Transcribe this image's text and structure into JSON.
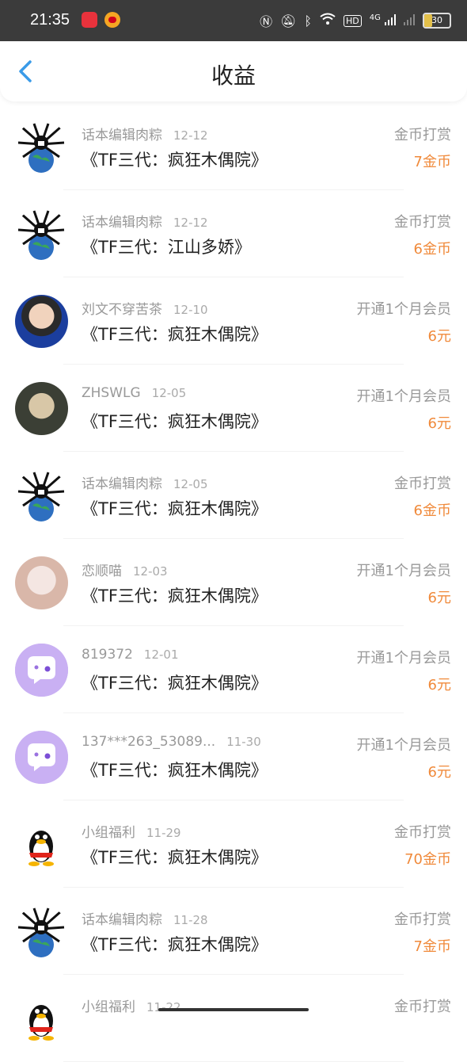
{
  "status_bar": {
    "time": "21:35",
    "network_label": "4G",
    "battery": "30",
    "hd_label": "HD"
  },
  "header": {
    "title": "收益",
    "back_icon": "chevron-left-icon"
  },
  "colors": {
    "accent_blue": "#3a9be8",
    "amount_orange": "#f08a3b",
    "avatar_default": "#c9b0f3"
  },
  "rows": [
    {
      "avatar": "spider-avatar",
      "user": "话本编辑肉粽",
      "date": "12-12",
      "title": "《TF三代：疯狂木偶院》",
      "type": "金币打赏",
      "amount": "7金币"
    },
    {
      "avatar": "spider-avatar",
      "user": "话本编辑肉粽",
      "date": "12-12",
      "title": "《TF三代：江山多娇》",
      "type": "金币打赏",
      "amount": "6金币"
    },
    {
      "avatar": "person-avatar",
      "user": "刘文不穿苦茶",
      "date": "12-10",
      "title": "《TF三代：疯狂木偶院》",
      "type": "开通1个月会员",
      "amount": "6元"
    },
    {
      "avatar": "person-avatar",
      "user": "ZHSWLG",
      "date": "12-05",
      "title": "《TF三代：疯狂木偶院》",
      "type": "开通1个月会员",
      "amount": "6元"
    },
    {
      "avatar": "spider-avatar",
      "user": "话本编辑肉粽",
      "date": "12-05",
      "title": "《TF三代：疯狂木偶院》",
      "type": "金币打赏",
      "amount": "6金币"
    },
    {
      "avatar": "person-avatar",
      "user": "恋顺喵",
      "date": "12-03",
      "title": "《TF三代：疯狂木偶院》",
      "type": "开通1个月会员",
      "amount": "6元"
    },
    {
      "avatar": "default-avatar",
      "user": "819372",
      "date": "12-01",
      "title": "《TF三代：疯狂木偶院》",
      "type": "开通1个月会员",
      "amount": "6元"
    },
    {
      "avatar": "default-avatar",
      "user": "137***263_53089...",
      "date": "11-30",
      "title": "《TF三代：疯狂木偶院》",
      "type": "开通1个月会员",
      "amount": "6元"
    },
    {
      "avatar": "qq-penguin-avatar",
      "user": "小组福利",
      "date": "11-29",
      "title": "《TF三代：疯狂木偶院》",
      "type": "金币打赏",
      "amount": "70金币"
    },
    {
      "avatar": "spider-avatar",
      "user": "话本编辑肉粽",
      "date": "11-28",
      "title": "《TF三代：疯狂木偶院》",
      "type": "金币打赏",
      "amount": "7金币"
    },
    {
      "avatar": "qq-penguin-avatar",
      "user": "小组福利",
      "date": "11-22",
      "title": "",
      "type": "金币打赏",
      "amount": ""
    }
  ]
}
